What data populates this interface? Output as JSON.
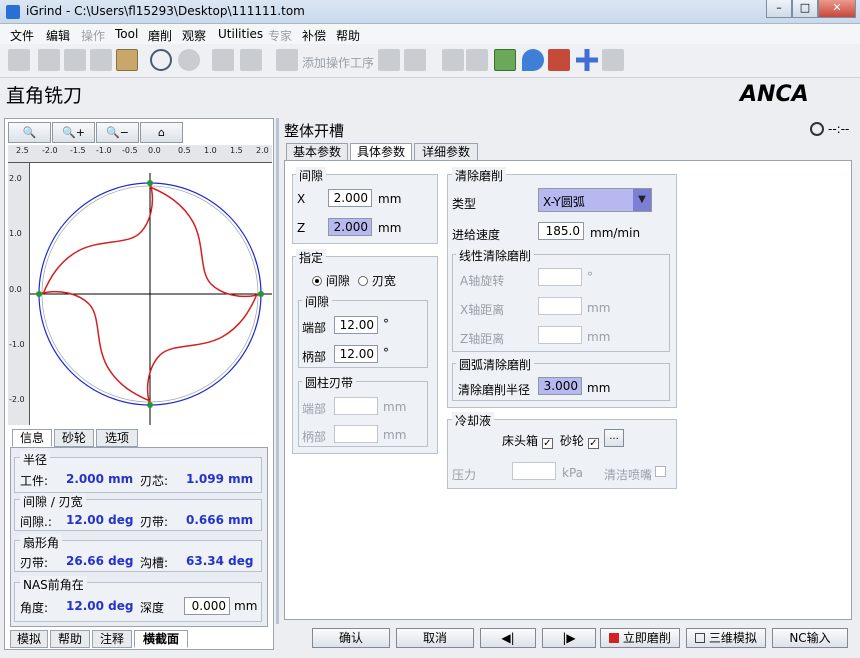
{
  "window": {
    "title": "iGrind - C:\\Users\\fl15293\\Desktop\\111111.tom",
    "buttons": [
      "–",
      "□",
      "✕"
    ]
  },
  "menu": [
    "文件",
    "编辑",
    "操作",
    "Tool",
    "磨削",
    "观察",
    "Utilities",
    "专家",
    "补偿",
    "帮助"
  ],
  "toolbar": {
    "add_operation_label": "添加操作工序"
  },
  "page_heading": "直角铣刀",
  "logo_text": "ANCA",
  "timer_text": "--:--",
  "left": {
    "zoom_buttons": [
      "🔍",
      "🔍+",
      "🔍−",
      "⌂"
    ],
    "ruler_x": [
      "2.5",
      "-2.0",
      "-1.5",
      "-1.0",
      "-0.5",
      "0.0",
      "0.5",
      "1.0",
      "1.5",
      "2.0"
    ],
    "ruler_y": [
      "2.0",
      "1.0",
      "0.0",
      "-1.0",
      "-2.0"
    ],
    "top_tabs": [
      "信息",
      "砂轮",
      "选项"
    ],
    "info": {
      "radius": {
        "title": "半径",
        "work_label": "工件:",
        "work_value": "2.000 mm",
        "core_label": "刃芯:",
        "core_value": "1.099 mm"
      },
      "clearance": {
        "title": "间隙 / 刃宽",
        "gap_label": "间隙.:",
        "gap_value": "12.00 deg",
        "land_label": "刃带:",
        "land_value": "0.666 mm"
      },
      "sector": {
        "title": "扇形角",
        "land_label": "刃带:",
        "land_value": "26.66 deg",
        "flute_label": "沟槽:",
        "flute_value": "63.34 deg"
      },
      "nas": {
        "title": "NAS前角在",
        "angle_label": "角度:",
        "angle_value": "12.00 deg",
        "depth_label": "深度",
        "depth_value": "0.000",
        "depth_unit": "mm"
      }
    },
    "bottom_tabs": [
      "模拟",
      "帮助",
      "注释",
      "横截面"
    ]
  },
  "right": {
    "section_title": "整体开槽",
    "tabs": [
      "基本参数",
      "具体参数",
      "详细参数"
    ],
    "gap_group": {
      "title": "间隙",
      "x_label": "X",
      "x_value": "2.000",
      "x_unit": "mm",
      "z_label": "Z",
      "z_value": "2.000",
      "z_unit": "mm"
    },
    "specify_group": {
      "title": "指定",
      "opt1": "间隙",
      "opt2": "刃宽",
      "sub_gap": {
        "title": "间隙",
        "end_label": "端部",
        "end_value": "12.00",
        "end_unit": "°",
        "shank_label": "柄部",
        "shank_value": "12.00",
        "shank_unit": "°"
      },
      "sub_land": {
        "title": "圆柱刃带",
        "end_label": "端部",
        "end_unit": "mm",
        "shank_label": "柄部",
        "shank_unit": "mm"
      }
    },
    "clean_group": {
      "title": "清除磨削",
      "type_label": "类型",
      "type_value": "X-Y圆弧",
      "feed_label": "进给速度",
      "feed_value": "185.0",
      "feed_unit": "mm/min",
      "linear": {
        "title": "线性清除磨削",
        "a_label": "A轴旋转",
        "a_unit": "°",
        "x_label": "X轴距离",
        "x_unit": "mm",
        "z_label": "Z轴距离",
        "z_unit": "mm"
      },
      "arc": {
        "title": "圆弧清除磨削",
        "radius_label": "清除磨削半径",
        "radius_value": "3.000",
        "radius_unit": "mm"
      }
    },
    "coolant_group": {
      "title": "冷却液",
      "headstock_label": "床头箱",
      "wheel_label": "砂轮",
      "more": "...",
      "pressure_label": "压力",
      "pressure_unit": "kPa",
      "clean_label": "清洁喷嘴"
    },
    "buttons": {
      "ok": "确认",
      "cancel": "取消",
      "prev": "◀|",
      "next": "|▶",
      "grind": "立即磨削",
      "sim3d": "三维模拟",
      "nc": "NC输入"
    }
  },
  "colors": {
    "accent": "#2533c9",
    "highlight": "#b7b8f0",
    "profile": "#d42020",
    "circle": "#1b2bd6"
  }
}
